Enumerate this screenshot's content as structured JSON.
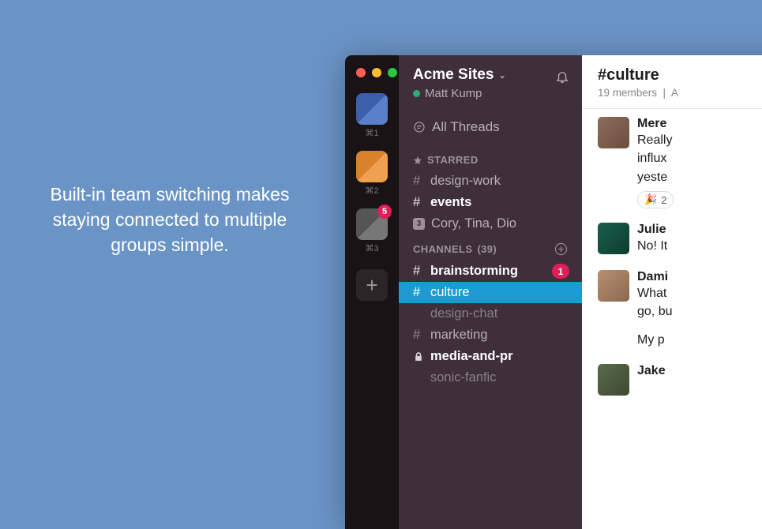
{
  "marketing": {
    "text": "Built-in team switching makes staying connected to multiple groups simple."
  },
  "teamRail": {
    "shortcuts": [
      "⌘1",
      "⌘2",
      "⌘3"
    ],
    "badge": "5"
  },
  "sidebar": {
    "teamName": "Acme Sites",
    "userName": "Matt Kump",
    "allThreads": "All Threads",
    "starredLabel": "STARRED",
    "starred": [
      {
        "name": "design-work",
        "bold": false
      },
      {
        "name": "events",
        "bold": true
      }
    ],
    "dm": {
      "count": "3",
      "names": "Cory, Tina, Dio"
    },
    "channelsLabel": "CHANNELS",
    "channelsCount": "(39)",
    "channels": [
      {
        "name": "brainstorming",
        "bold": true,
        "mentions": "1",
        "type": "public"
      },
      {
        "name": "culture",
        "active": true,
        "type": "public"
      },
      {
        "name": "design-chat",
        "muted": true,
        "type": "public-muted"
      },
      {
        "name": "marketing",
        "type": "public"
      },
      {
        "name": "media-and-pr",
        "bold": true,
        "type": "private"
      },
      {
        "name": "sonic-fanfic",
        "muted": true,
        "type": "public-muted"
      }
    ]
  },
  "main": {
    "channelTitle": "#culture",
    "memberCount": "19 members",
    "metaSep": "|",
    "metaExtra": "A",
    "messages": [
      {
        "author": "Mere",
        "line1": "Really",
        "line2": "influx",
        "line3": "yeste",
        "reaction": {
          "emoji": "🎉",
          "count": "2"
        }
      },
      {
        "author": "Julie",
        "line1": "No! It"
      },
      {
        "author": "Dami",
        "line1": "What",
        "line2": "go, bu",
        "line3": "My p"
      },
      {
        "author": "Jake"
      }
    ]
  }
}
